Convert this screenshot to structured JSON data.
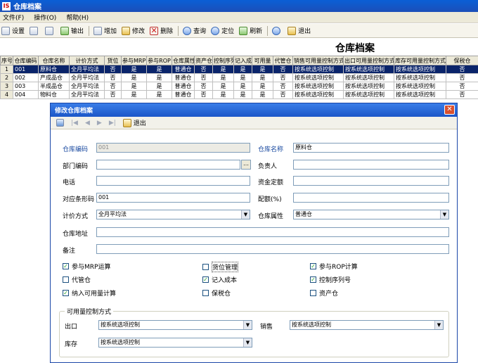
{
  "window": {
    "title": "仓库档案",
    "logo": "IS"
  },
  "menu": [
    {
      "label": "文件(F)"
    },
    {
      "label": "操作(O)"
    },
    {
      "label": "帮助(H)"
    }
  ],
  "toolbar": {
    "setup": "设置",
    "output": "输出",
    "add": "增加",
    "edit": "修改",
    "delete": "删除",
    "query": "查询",
    "locate": "定位",
    "refresh": "刷新",
    "exit": "退出"
  },
  "content": {
    "title": "仓库档案"
  },
  "table": {
    "headers": [
      "序号",
      "仓库编码",
      "仓库名称",
      "计价方式",
      "货位管理",
      "参与MRP",
      "参与ROP",
      "仓库属性",
      "资产仓",
      "控制序列号",
      "记入成本",
      "可用量",
      "代管仓",
      "销售可用量控制方式",
      "出口可用量控制方式",
      "库存可用量控制方式",
      "保税仓"
    ],
    "header_display": [
      "序号",
      "仓库编码",
      "仓库名称",
      "计价方式",
      "货位",
      "参与MRP",
      "参与ROP",
      "仓库属性",
      "资产仓",
      "控制序列",
      "记入成本",
      "可用量",
      "代管仓",
      "销售可用量控制方式",
      "出口可用量控制方式",
      "库存可用量控制方式",
      "保税仓"
    ],
    "rows": [
      [
        "1",
        "001",
        "原料仓",
        "全月平均法",
        "否",
        "是",
        "是",
        "普通仓",
        "否",
        "是",
        "是",
        "是",
        "否",
        "按系统选项控制",
        "按系统选项控制",
        "按系统选项控制",
        "否"
      ],
      [
        "2",
        "002",
        "产成品仓",
        "全月平均法",
        "否",
        "是",
        "是",
        "普通仓",
        "否",
        "是",
        "是",
        "是",
        "否",
        "按系统选项控制",
        "按系统选项控制",
        "按系统选项控制",
        "否"
      ],
      [
        "3",
        "003",
        "半成品仓",
        "全月平均法",
        "否",
        "是",
        "是",
        "普通仓",
        "否",
        "是",
        "是",
        "是",
        "否",
        "按系统选项控制",
        "按系统选项控制",
        "按系统选项控制",
        "否"
      ],
      [
        "4",
        "004",
        "物料仓",
        "全月平均法",
        "否",
        "是",
        "是",
        "普通仓",
        "否",
        "是",
        "是",
        "是",
        "否",
        "按系统选项控制",
        "按系统选项控制",
        "按系统选项控制",
        "否"
      ]
    ]
  },
  "dialog": {
    "title": "修改仓库档案",
    "exit_label": "退出",
    "fields": {
      "code_label": "仓库编码",
      "code_value": "001",
      "name_label": "仓库名称",
      "name_value": "原料仓",
      "dept_label": "部门编码",
      "dept_value": "",
      "owner_label": "负责人",
      "owner_value": "",
      "phone_label": "电话",
      "phone_value": "",
      "fund_label": "资金定额",
      "fund_value": "",
      "barcode_label": "对应条形码",
      "barcode_value": "001",
      "quota_label": "配额(%)",
      "quota_value": "",
      "pricing_label": "计价方式",
      "pricing_value": "全月平均法",
      "attr_label": "仓库属性",
      "attr_value": "普通仓",
      "address_label": "仓库地址",
      "address_value": "",
      "remark_label": "备注",
      "remark_value": ""
    },
    "checks": [
      {
        "label": "参与MRP运算",
        "checked": true
      },
      {
        "label": "货位管理",
        "checked": false
      },
      {
        "label": "参与ROP计算",
        "checked": true
      },
      {
        "label": "代管仓",
        "checked": false
      },
      {
        "label": "记入成本",
        "checked": true
      },
      {
        "label": "控制序列号",
        "checked": true
      },
      {
        "label": "纳入可用量计算",
        "checked": true
      },
      {
        "label": "保税仓",
        "checked": false
      },
      {
        "label": "资产仓",
        "checked": false
      }
    ],
    "group": {
      "title": "可用量控制方式",
      "export_label": "出口",
      "export_value": "按系统选项控制",
      "sales_label": "销售",
      "sales_value": "按系统选项控制",
      "stock_label": "库存",
      "stock_value": "按系统选项控制"
    }
  }
}
